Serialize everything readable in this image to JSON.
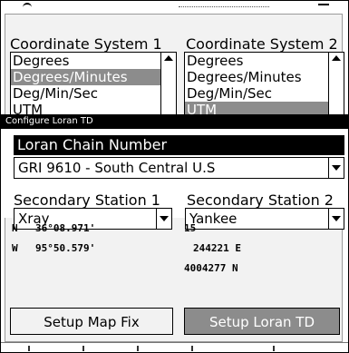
{
  "coordinate_system_1": {
    "label": "Coordinate System 1",
    "items": [
      "Degrees",
      "Degrees/Minutes",
      "Deg/Min/Sec",
      "UTM"
    ],
    "selected_index": 1
  },
  "coordinate_system_2": {
    "label": "Coordinate System 2",
    "items": [
      "Degrees",
      "Degrees/Minutes",
      "Deg/Min/Sec",
      "UTM"
    ],
    "selected_index": 3
  },
  "dialog": {
    "title": "Configure Loran TD",
    "chain_label": "Loran Chain Number",
    "chain_value": "GRI 9610 - South Central U.S",
    "secondary_1_label": "Secondary Station 1",
    "secondary_1_value": "Xray",
    "secondary_2_label": "Secondary Station 2",
    "secondary_2_value": "Yankee"
  },
  "readout": {
    "lat_hemisphere": "N",
    "lat_value": "36°08.971'",
    "lon_hemisphere": "W",
    "lon_value": "95°50.579'",
    "zone": "15",
    "easting": "244221 E",
    "northing": "4004277 N"
  },
  "buttons": {
    "setup_map_fix": "Setup Map Fix",
    "setup_loran_td": "Setup Loran TD"
  },
  "colors": {
    "selection": "#8c8c8c",
    "title_bar": "#000000",
    "panel": "#f2f2f2"
  }
}
